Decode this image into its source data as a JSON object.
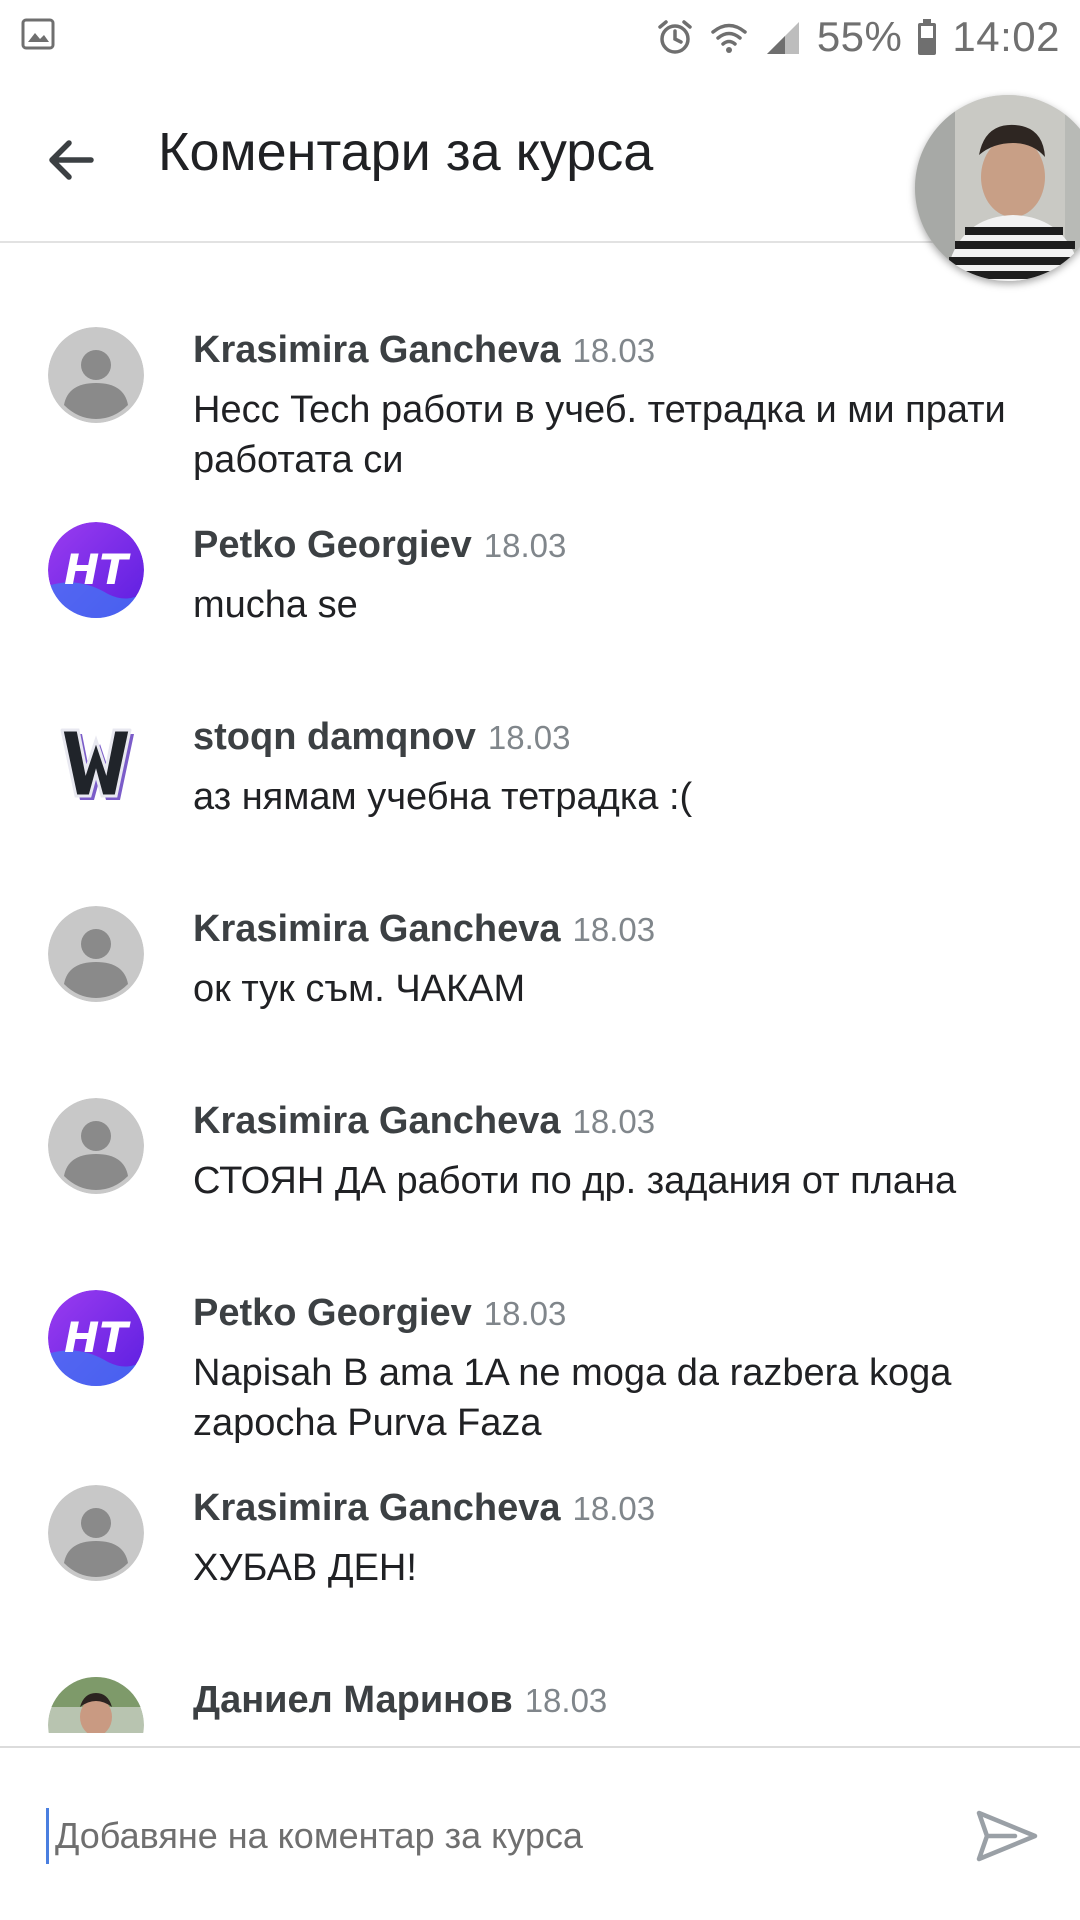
{
  "status_bar": {
    "gallery_icon": "image-icon",
    "alarm_icon": "alarm-icon",
    "wifi_icon": "wifi-icon",
    "signal_icon": "signal-icon",
    "battery_icon": "battery-icon",
    "battery_percent": "55%",
    "time": "14:02"
  },
  "header": {
    "back_icon": "arrow-back-icon",
    "title": "Коментари за курса",
    "avatar_icon": "user-photo-avatar"
  },
  "comments": [
    {
      "author": "Krasimira Gancheva",
      "date": "18.03",
      "text": "Несс Tech работи в учеб. тетрадка  и ми прати работата си",
      "avatar": "default-person-icon"
    },
    {
      "author": "Petko Georgiev",
      "date": "18.03",
      "text": "mucha se",
      "avatar": "ht-logo-avatar"
    },
    {
      "author": "stoqn damqnov",
      "date": "18.03",
      "text": "аз нямам учебна тетрадка :(",
      "avatar": "w-logo-avatar"
    },
    {
      "author": "Krasimira Gancheva",
      "date": "18.03",
      "text": "ок тук съм. ЧАКАМ",
      "avatar": "default-person-icon"
    },
    {
      "author": "Krasimira Gancheva",
      "date": "18.03",
      "text": "СТОЯН ДА работи по др. задания от плана",
      "avatar": "default-person-icon"
    },
    {
      "author": "Petko Georgiev",
      "date": "18.03",
      "text": "Napisah B ama 1A ne moga da razbera koga zapocha Purva Faza",
      "avatar": "ht-logo-avatar"
    },
    {
      "author": "Krasimira Gancheva",
      "date": "18.03",
      "text": "ХУБАВ ДЕН!",
      "avatar": "default-person-icon"
    },
    {
      "author": "Даниел Маринов",
      "date": "18.03",
      "text": "",
      "avatar": "user-photo-avatar"
    }
  ],
  "composer": {
    "placeholder": "Добавяне на коментар за курса",
    "value": "",
    "send_icon": "send-icon"
  },
  "colors": {
    "title_text": "#202124",
    "author_text": "#3c4043",
    "date_text": "#80868b",
    "default_avatar_bg": "#c8c8c8",
    "default_avatar_fg": "#8a8a8a",
    "ht_avatar_purple": "#7b2ff7",
    "divider": "#e2e2e2"
  }
}
